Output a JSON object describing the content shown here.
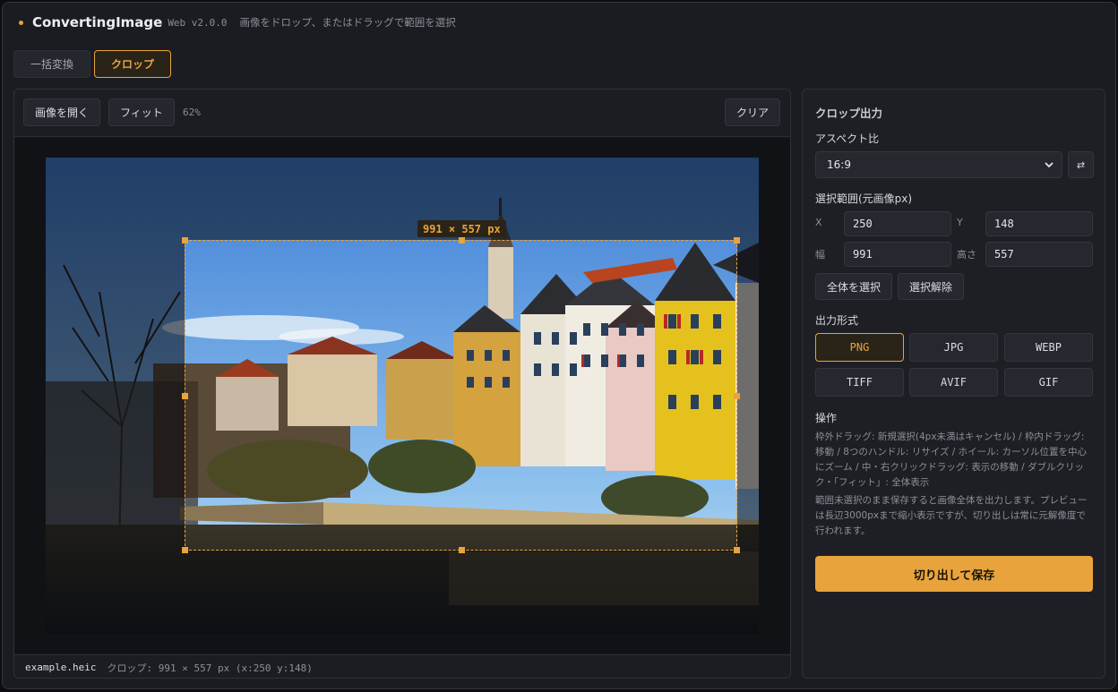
{
  "header": {
    "app_name": "ConvertingImage",
    "version": "Web v2.0.0",
    "hint": "画像をドロップ、またはドラッグで範囲を選択"
  },
  "tabs": [
    {
      "label": "一括変換",
      "active": false
    },
    {
      "label": "クロップ",
      "active": true
    }
  ],
  "toolbar": {
    "open_label": "画像を開く",
    "fit_label": "フィット",
    "zoom": "62%",
    "clear_label": "クリア"
  },
  "canvas": {
    "size_label": "991 × 557 px"
  },
  "status": {
    "filename": "example.heic",
    "crop_info": "クロップ: 991 × 557 px (x:250 y:148)"
  },
  "panel": {
    "title": "クロップ出力",
    "aspect_label": "アスペクト比",
    "aspect_value": "16:9",
    "swap_icon": "⇄",
    "range_label": "選択範囲(元画像px)",
    "fields": {
      "x_label": "X",
      "x_value": "250",
      "y_label": "Y",
      "y_value": "148",
      "w_label": "幅",
      "w_value": "991",
      "h_label": "高さ",
      "h_value": "557"
    },
    "select_all_label": "全体を選択",
    "deselect_label": "選択解除",
    "format_label": "出力形式",
    "formats": [
      {
        "label": "PNG",
        "active": true
      },
      {
        "label": "JPG",
        "active": false
      },
      {
        "label": "WEBP",
        "active": false
      },
      {
        "label": "TIFF",
        "active": false
      },
      {
        "label": "AVIF",
        "active": false
      },
      {
        "label": "GIF",
        "active": false
      }
    ],
    "ops_label": "操作",
    "ops_text": "枠外ドラッグ: 新規選択(4px未満はキャンセル) / 枠内ドラッグ: 移動 / 8つのハンドル: リサイズ / ホイール: カーソル位置を中心にズーム / 中・右クリックドラッグ: 表示の移動 / ダブルクリック・「フィット」: 全体表示",
    "note_text": "範囲未選択のまま保存すると画像全体を出力します。プレビューは長辺3000pxまで縮小表示ですが、切り出しは常に元解像度で行われます。",
    "save_label": "切り出して保存"
  },
  "colors": {
    "accent": "#e8a33d",
    "background": "#1a1c21",
    "panel": "#1d1f24"
  }
}
